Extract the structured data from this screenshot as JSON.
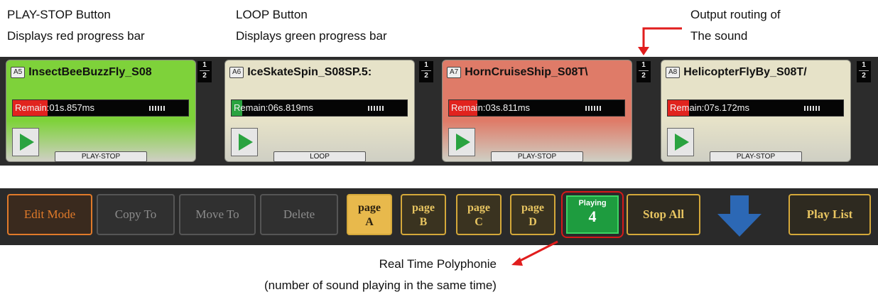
{
  "annotations": {
    "play_stop": [
      "PLAY-STOP Button",
      "Displays red progress bar"
    ],
    "loop": [
      "LOOP Button",
      "Displays green progress bar"
    ],
    "output": [
      "Output routing of",
      "The sound"
    ],
    "polyphony": [
      "Real Time Polyphonie",
      "(number of sound playing in the same time)"
    ]
  },
  "pads": [
    {
      "slot": "A5",
      "title": "InsectBeeBuzzFly_S08",
      "remain": "Remain:01s.857ms",
      "mode": "PLAY-STOP",
      "bg_color": "#7ed23a",
      "progress_color": "#e1231e",
      "progress": 0.2,
      "route_top": "1",
      "route_bottom": "2"
    },
    {
      "slot": "A6",
      "title": "IceSkateSpin_S08SP.5:",
      "remain": "Remain:06s.819ms",
      "mode": "LOOP",
      "bg_color": "#e6e2c8",
      "progress_color": "#2aa340",
      "progress": 0.06,
      "route_top": "1",
      "route_bottom": "2"
    },
    {
      "slot": "A7",
      "title": "HornCruiseShip_S08T\\",
      "remain": "Remain:03s.811ms",
      "mode": "PLAY-STOP",
      "bg_color": "#df7b68",
      "progress_color": "#e1231e",
      "progress": 0.16,
      "route_top": "1",
      "route_bottom": "2"
    },
    {
      "slot": "A8",
      "title": "HelicopterFlyBy_S08T/",
      "remain": "Remain:07s.172ms",
      "mode": "PLAY-STOP",
      "bg_color": "#e6e2c8",
      "progress_color": "#e1231e",
      "progress": 0.12,
      "route_top": "1",
      "route_bottom": "2"
    }
  ],
  "toolbar": {
    "edit_mode": "Edit Mode",
    "copy_to": "Copy To",
    "move_to": "Move To",
    "delete": "Delete",
    "pages": [
      {
        "line1": "page",
        "line2": "A",
        "active": true
      },
      {
        "line1": "page",
        "line2": "B",
        "active": false
      },
      {
        "line1": "page",
        "line2": "C",
        "active": false
      },
      {
        "line1": "page",
        "line2": "D",
        "active": false
      }
    ],
    "playing_label": "Playing",
    "playing_count": "4",
    "stop_all": "Stop All",
    "play_list": "Play List"
  },
  "colors": {
    "callout_red": "#e11d1d",
    "edit_mode_accent": "#e07a2a",
    "page_gold": "#d4a83a",
    "playing_green": "#1e9c3f",
    "arrow_blue": "#2c6fc4"
  }
}
